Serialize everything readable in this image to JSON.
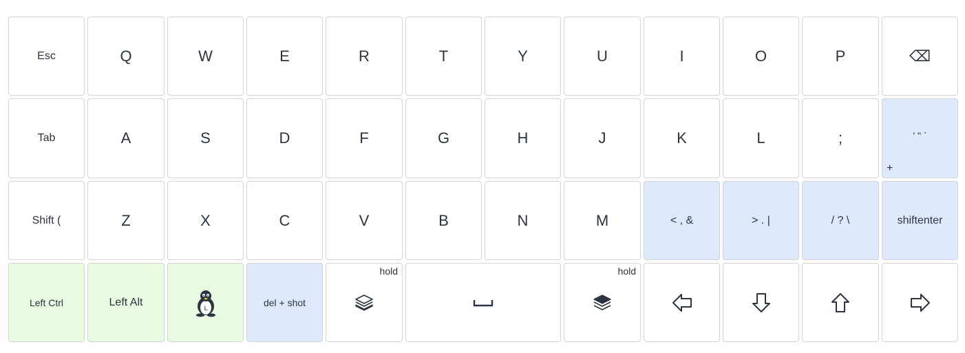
{
  "rows": [
    [
      "Esc",
      "Q",
      "W",
      "E",
      "R",
      "T",
      "Y",
      "U",
      "I",
      "O",
      "P",
      "⌫"
    ],
    [
      "Tab",
      "A",
      "S",
      "D",
      "F",
      "G",
      "H",
      "J",
      "K",
      "L",
      ";",
      "' \" `"
    ],
    [
      "Shift (",
      "Z",
      "X",
      "C",
      "V",
      "B",
      "N",
      "M",
      "< , &",
      "> . |",
      "/ ? \\",
      "shiftenter"
    ]
  ],
  "bottom": {
    "left_ctrl": "Left Ctrl",
    "left_alt": "Left Alt",
    "os_icon": "linux-tux-icon",
    "del_shot": "del + shot",
    "layer_low_hold": "hold",
    "layer_raise_hold": "hold",
    "space_icon": "space-bar-icon",
    "arrows": [
      "left-arrow-icon",
      "down-arrow-icon",
      "up-arrow-icon",
      "right-arrow-icon"
    ]
  },
  "quote_key_hold": "+",
  "colors": {
    "blue": "#dfe9fc",
    "green": "#e8fbe0",
    "border": "#d4d4d4",
    "text": "#2d3340"
  }
}
